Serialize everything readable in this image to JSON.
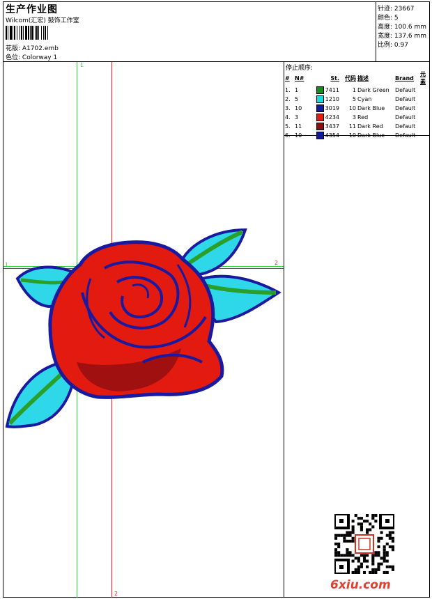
{
  "header": {
    "title": "生产作业图",
    "subtitle": "Wilcom(汇宏) 鼓饰工作室",
    "design_label": "花版:",
    "design_value": "A1702.emb",
    "colorway_label": "色位:",
    "colorway_value": "Colorway 1"
  },
  "stats": {
    "stitches": "针迹: 23667",
    "colors": "颜色: 5",
    "height": "高度: 100.6 mm",
    "width": "宽度: 137.6 mm",
    "scale": "比例: 0.97"
  },
  "stop_sequence": {
    "title": "停止顺序:",
    "headers": [
      "#",
      "N#",
      "St.",
      "代码",
      "描述",
      "Brand",
      "元素"
    ],
    "rows": [
      {
        "idx": "1.",
        "n": "1",
        "swatch": "#1a8a1a",
        "st": "7411",
        "code": "1",
        "desc": "Dark Green",
        "brand": "Default"
      },
      {
        "idx": "2.",
        "n": "5",
        "swatch": "#22d6e0",
        "st": "1210",
        "code": "5",
        "desc": "Cyan",
        "brand": "Default"
      },
      {
        "idx": "3.",
        "n": "10",
        "swatch": "#101a9a",
        "st": "3019",
        "code": "10",
        "desc": "Dark Blue",
        "brand": "Default"
      },
      {
        "idx": "4.",
        "n": "3",
        "swatch": "#e41c10",
        "st": "4234",
        "code": "3",
        "desc": "Red",
        "brand": "Default"
      },
      {
        "idx": "5.",
        "n": "11",
        "swatch": "#8a1010",
        "st": "3437",
        "code": "11",
        "desc": "Dark Red",
        "brand": "Default"
      },
      {
        "idx": "6.",
        "n": "10",
        "swatch": "#101a9a",
        "st": "4354",
        "code": "10",
        "desc": "Dark Blue",
        "brand": "Default"
      }
    ]
  },
  "guides": {
    "v1": "1",
    "v2": "2",
    "h1": "1",
    "h2": "2"
  },
  "colors": {
    "leaf": "#2aa02a",
    "leaf_light": "#2fd8e8",
    "petal": "#e21a10",
    "petal_dark": "#a01010",
    "outline": "#1a1aa0",
    "guide_green": "#2ecc40",
    "guide_red": "#e02020"
  },
  "watermark": "6xiu.com"
}
